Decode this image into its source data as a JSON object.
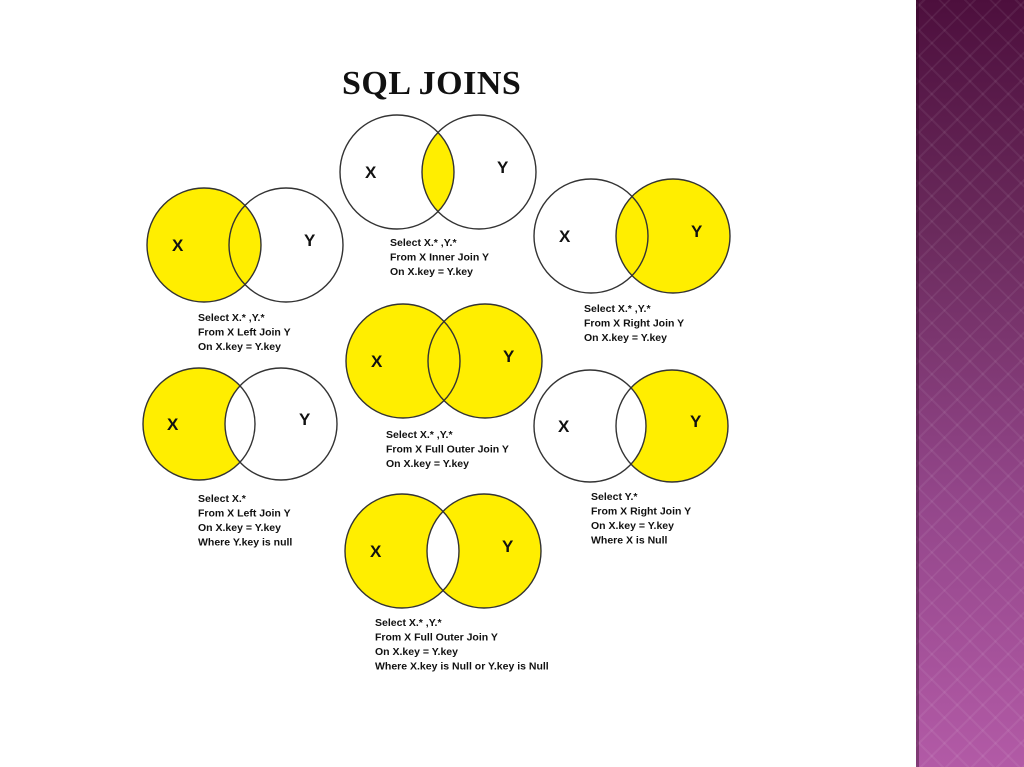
{
  "title": "SQL JOINS",
  "colors": {
    "highlight": "#ffee00",
    "outline": "#333333",
    "background": "#ffffff",
    "band_top": "#4d0f3d",
    "band_bottom": "#b25aa6"
  },
  "diagrams": [
    {
      "id": "inner-join",
      "set_x": "X",
      "set_y": "Y",
      "shade": "intersection",
      "query": [
        "Select X.* ,Y.*",
        "From X Inner Join Y",
        "On X.key = Y.key"
      ]
    },
    {
      "id": "left-join",
      "set_x": "X",
      "set_y": "Y",
      "shade": "left",
      "query": [
        "Select X.* ,Y.*",
        "From X Left Join Y",
        "On X.key = Y.key"
      ]
    },
    {
      "id": "right-join",
      "set_x": "X",
      "set_y": "Y",
      "shade": "right",
      "query": [
        "Select X.* ,Y.*",
        "From X Right Join Y",
        "On X.key = Y.key"
      ]
    },
    {
      "id": "full-outer-join",
      "set_x": "X",
      "set_y": "Y",
      "shade": "both",
      "query": [
        "Select X.* ,Y.*",
        "From X Full Outer Join Y",
        "On X.key = Y.key"
      ]
    },
    {
      "id": "left-join-exclusive",
      "set_x": "X",
      "set_y": "Y",
      "shade": "left-only",
      "query": [
        "Select X.*",
        "From X Left Join Y",
        "On X.key = Y.key",
        "Where Y.key is null"
      ]
    },
    {
      "id": "right-join-exclusive",
      "set_x": "X",
      "set_y": "Y",
      "shade": "right-only",
      "query": [
        "Select Y.*",
        "From X Right Join Y",
        "On X.key = Y.key",
        "Where  X is Null"
      ]
    },
    {
      "id": "full-outer-join-exclusive",
      "set_x": "X",
      "set_y": "Y",
      "shade": "symmetric-difference",
      "query": [
        "Select X.* ,Y.*",
        "From X Full Outer Join Y",
        "On X.key = Y.key",
        "Where X.key is Null or Y.key is Null"
      ]
    }
  ]
}
